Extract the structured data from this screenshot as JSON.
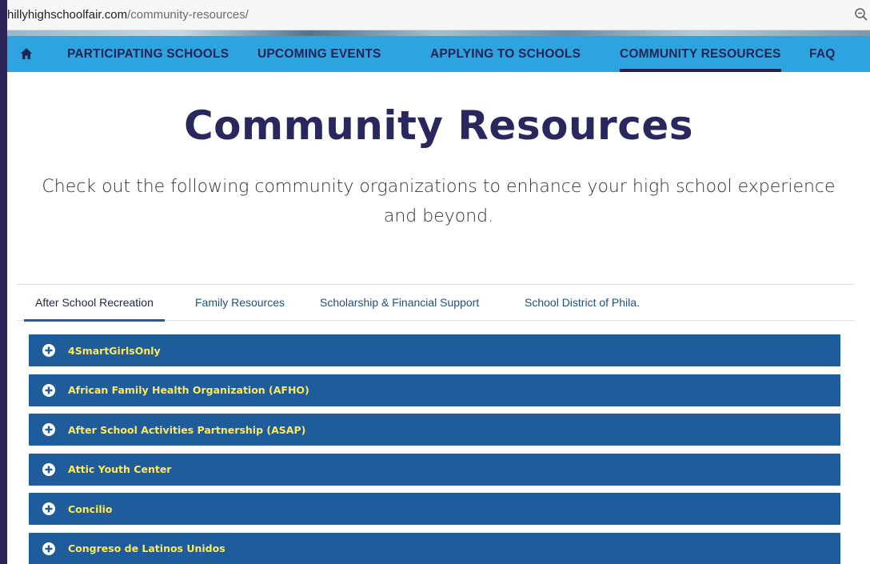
{
  "browser": {
    "url_domain": "hillyhighschoolfair.com",
    "url_path": "/community-resources/"
  },
  "nav": {
    "items": [
      {
        "label": "PARTICIPATING SCHOOLS"
      },
      {
        "label": "UPCOMING EVENTS"
      },
      {
        "label": "APPLYING TO SCHOOLS"
      },
      {
        "label": "COMMUNITY RESOURCES",
        "active": true
      },
      {
        "label": "FAQ"
      }
    ]
  },
  "main": {
    "title": "Community Resources",
    "intro": "Check out the following community organizations to enhance your high school experience and beyond."
  },
  "tabs": [
    {
      "label": "After School Recreation",
      "active": true
    },
    {
      "label": "Family Resources"
    },
    {
      "label": "Scholarship & Financial Support"
    },
    {
      "label": "School District of Phila."
    }
  ],
  "accordion": [
    {
      "label": "4SmartGirlsOnly"
    },
    {
      "label": "African Family Health Organization (AFHO)"
    },
    {
      "label": "After School Activities Partnership (ASAP)"
    },
    {
      "label": "Attic Youth Center"
    },
    {
      "label": "Concilio"
    },
    {
      "label": "Congreso de Latinos Unidos"
    }
  ],
  "colors": {
    "nav_bg": "#2da3e0",
    "title": "#28285e",
    "accordion_bg": "#1f5c9c",
    "accordion_text": "#ffe85a",
    "frame": "#2b2457"
  },
  "icons": {
    "home": "home-icon",
    "zoom": "zoom-icon",
    "accordion": "plus-circle-icon"
  }
}
